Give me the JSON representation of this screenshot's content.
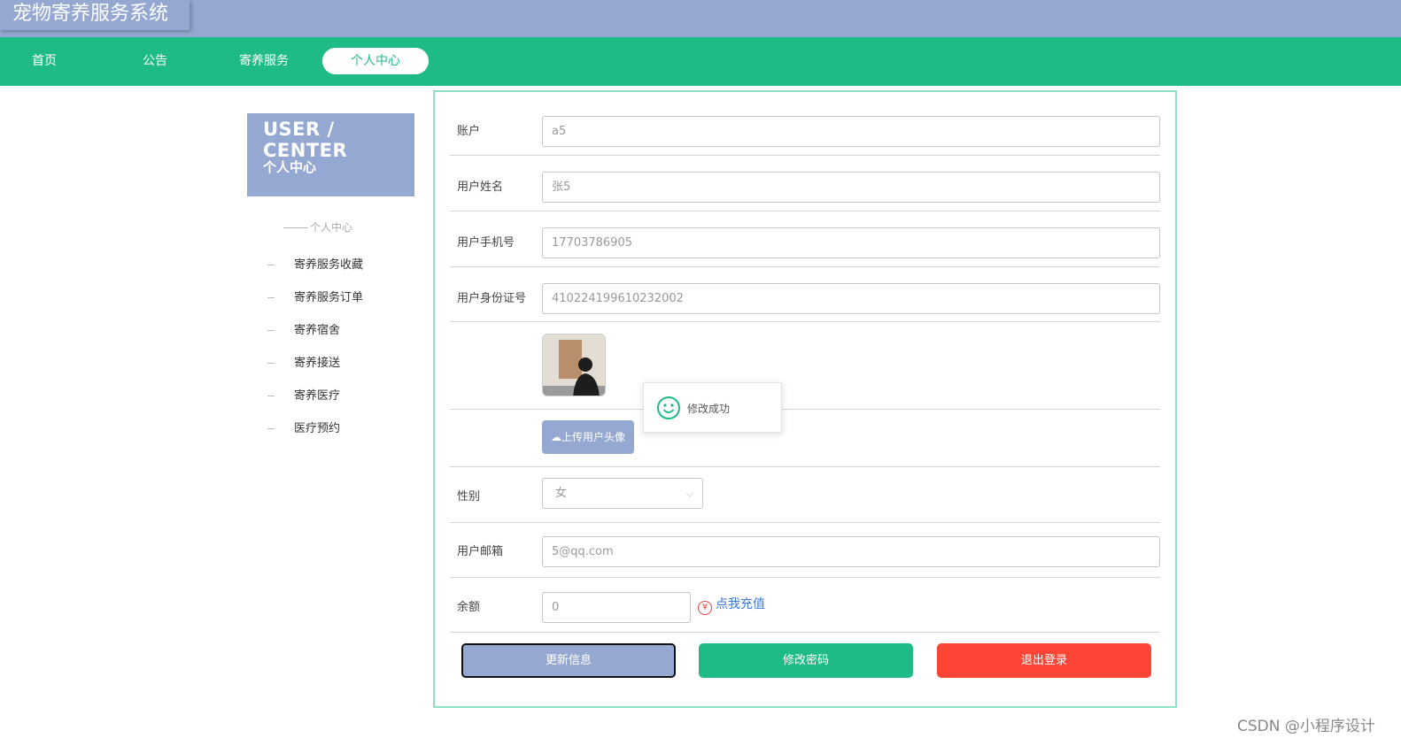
{
  "header": {
    "title": "宠物寄养服务系统"
  },
  "nav": {
    "items": [
      "首页",
      "公告",
      "寄养服务",
      "个人中心"
    ],
    "active": "个人中心"
  },
  "sidebar": {
    "title": "USER / CENTER",
    "subtitle": "个人中心",
    "section_header": "个人中心",
    "items": [
      "寄养服务收藏",
      "寄养服务订单",
      "寄养宿舍",
      "寄养接送",
      "寄养医疗",
      "医疗预约"
    ]
  },
  "form": {
    "account": {
      "label": "账户",
      "value": "a5"
    },
    "name": {
      "label": "用户姓名",
      "value": "张5"
    },
    "phone": {
      "label": "用户手机号",
      "value": "17703786905"
    },
    "id_card": {
      "label": "用户身份证号",
      "value": "410224199610232002"
    },
    "upload_avatar_label": "上传用户头像",
    "gender": {
      "label": "性别",
      "value": "女"
    },
    "email": {
      "label": "用户邮箱",
      "value": "5@qq.com"
    },
    "balance": {
      "label": "余额",
      "value": "0"
    },
    "recharge_label": "点我充值"
  },
  "toast": {
    "message": "修改成功"
  },
  "buttons": {
    "update": "更新信息",
    "change_password": "修改密码",
    "logout": "退出登录"
  },
  "watermark": "CSDN @小程序设计",
  "colors": {
    "primary": "#94a8d2",
    "accent": "#1fbb86",
    "danger": "#fc4534",
    "link": "#3a78d8"
  }
}
